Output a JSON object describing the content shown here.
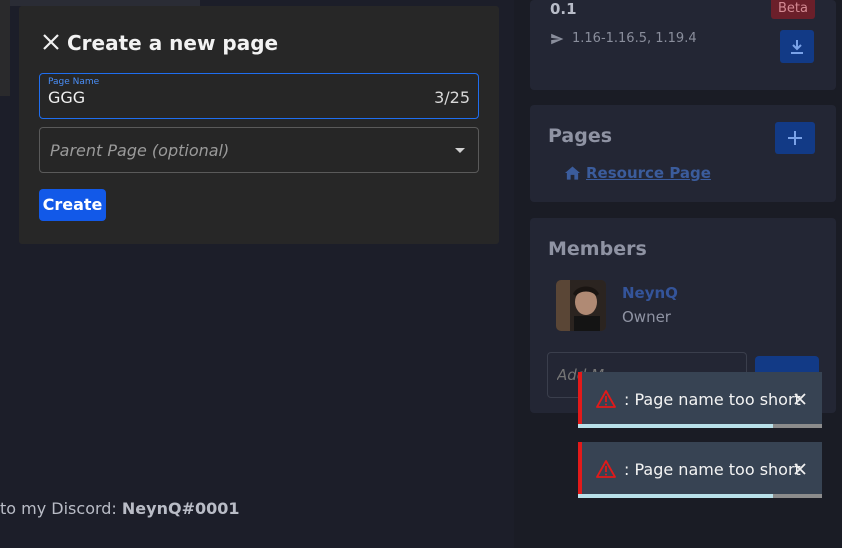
{
  "background": {
    "discord_prefix": "to my Discord: ",
    "discord_handle": "NeynQ#0001"
  },
  "sidebar": {
    "version": "0.1",
    "version_badge": "Beta",
    "mc_versions": "1.16-1.16.5, 1.19.4",
    "pages": {
      "title": "Pages",
      "items": [
        {
          "label": "Resource Page",
          "icon": "home-icon"
        }
      ]
    },
    "members": {
      "title": "Members",
      "items": [
        {
          "name": "NeynQ",
          "role": "Owner"
        }
      ],
      "add_placeholder": "Add M"
    }
  },
  "modal": {
    "title": "Create a new page",
    "name_field": {
      "label": "Page Name",
      "value": "GGG",
      "counter": "3/25"
    },
    "parent_select": {
      "placeholder": "Parent Page (optional)"
    },
    "create_label": "Create"
  },
  "toasts": [
    {
      "message": ": Page name too short",
      "progress": 0.8
    },
    {
      "message": ": Page name too short",
      "progress": 0.8
    }
  ],
  "colors": {
    "accent": "#1259e8",
    "error": "#e21a1a",
    "toast_bg": "#374353"
  }
}
